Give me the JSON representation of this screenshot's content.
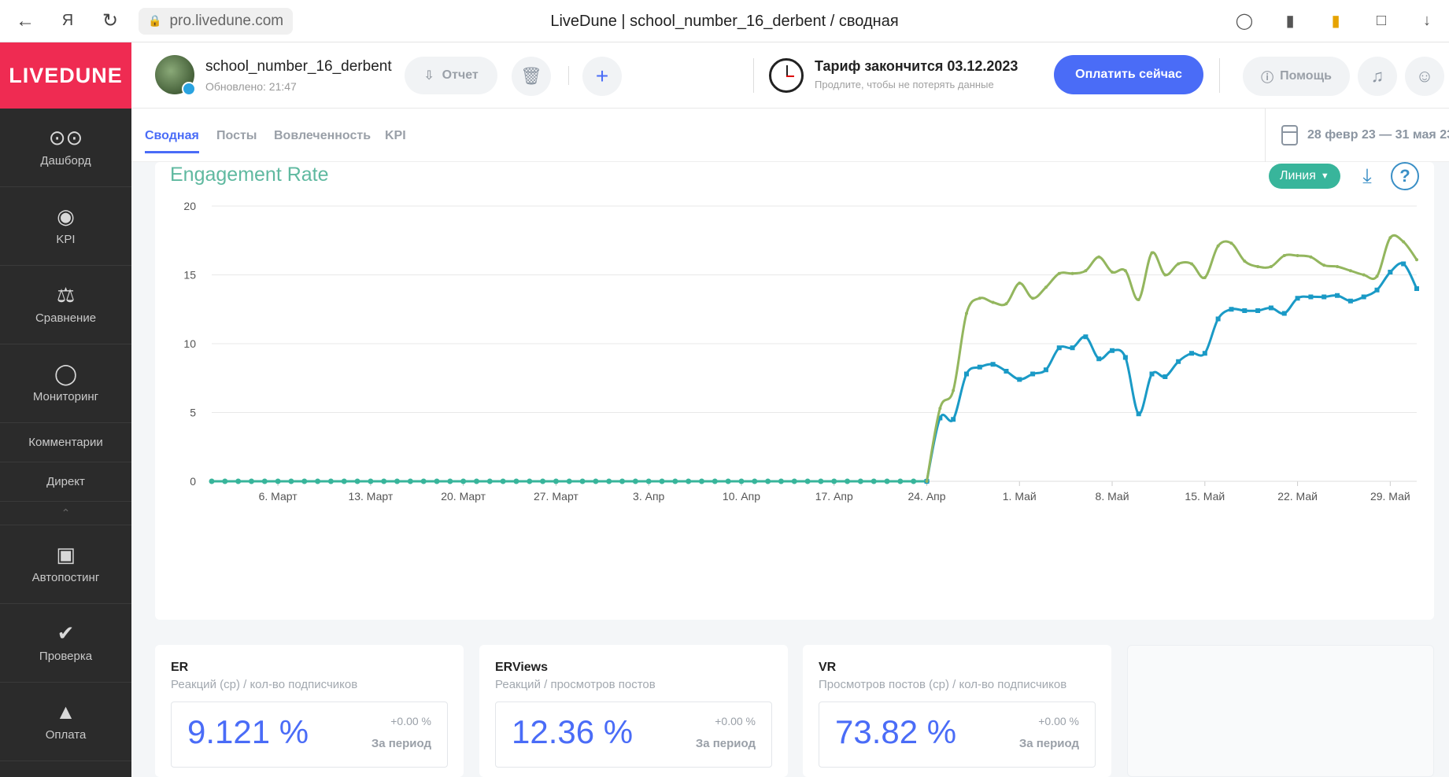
{
  "browser": {
    "url": "pro.livedune.com",
    "tab_title": "LiveDune | school_number_16_derbent / сводная"
  },
  "sidebar": {
    "brand": "LIVEDUNE",
    "items": [
      {
        "label": "Дашборд",
        "icon": "grid-icon"
      },
      {
        "label": "KPI",
        "icon": "target-icon"
      },
      {
        "label": "Сравнение",
        "icon": "scales-icon"
      },
      {
        "label": "Мониторинг",
        "icon": "chat-bubble-icon"
      }
    ],
    "sub_items": [
      "Комментарии",
      "Директ"
    ],
    "items2": [
      {
        "label": "Автопостинг",
        "icon": "calendar-plus-icon"
      },
      {
        "label": "Проверка",
        "icon": "shield-check-icon"
      },
      {
        "label": "Оплата",
        "icon": "basket-icon"
      }
    ]
  },
  "header": {
    "account_name": "school_number_16_derbent",
    "updated": "Обновлено: 21:47",
    "report_label": "Отчет",
    "tariff_title": "Тариф закончится 03.12.2023",
    "tariff_sub": "Продлите, чтобы не потерять данные",
    "pay_label": "Оплатить сейчас",
    "help_label": "Помощь"
  },
  "tabs": [
    "Сводная",
    "Посты",
    "Вовлеченность",
    "KPI"
  ],
  "date_range": "28 февр 23 — 31 мая 23",
  "chart": {
    "title": "Engagement Rate",
    "type_label": "Линия"
  },
  "chart_data": {
    "type": "line",
    "title": "Engagement Rate",
    "xlabel": "",
    "ylabel": "",
    "ylim": [
      0,
      20
    ],
    "yticks": [
      0,
      5,
      10,
      15,
      20
    ],
    "x_start": "2023-03-01",
    "x_ticks": [
      "6. Март",
      "13. Март",
      "20. Март",
      "27. Март",
      "3. Апр",
      "10. Апр",
      "17. Апр",
      "24. Апр",
      "1. Май",
      "8. Май",
      "15. Май",
      "22. Май",
      "29. Май"
    ],
    "grid": true,
    "legend": "none",
    "series": [
      {
        "color": "#93b65e",
        "values": [
          {
            "date": "2023-04-24",
            "value": 0
          },
          {
            "date": "2023-04-25",
            "value": 5.3
          },
          {
            "date": "2023-04-26",
            "value": 6.6
          },
          {
            "date": "2023-04-27",
            "value": 12.2
          },
          {
            "date": "2023-04-28",
            "value": 13.3
          },
          {
            "date": "2023-04-29",
            "value": 13.0
          },
          {
            "date": "2023-04-30",
            "value": 12.9
          },
          {
            "date": "2023-05-01",
            "value": 14.4
          },
          {
            "date": "2023-05-02",
            "value": 13.3
          },
          {
            "date": "2023-05-03",
            "value": 14.1
          },
          {
            "date": "2023-05-04",
            "value": 15.1
          },
          {
            "date": "2023-05-05",
            "value": 15.1
          },
          {
            "date": "2023-05-06",
            "value": 15.3
          },
          {
            "date": "2023-05-07",
            "value": 16.3
          },
          {
            "date": "2023-05-08",
            "value": 15.2
          },
          {
            "date": "2023-05-09",
            "value": 15.3
          },
          {
            "date": "2023-05-10",
            "value": 13.2
          },
          {
            "date": "2023-05-11",
            "value": 16.6
          },
          {
            "date": "2023-05-12",
            "value": 15.0
          },
          {
            "date": "2023-05-13",
            "value": 15.8
          },
          {
            "date": "2023-05-14",
            "value": 15.8
          },
          {
            "date": "2023-05-15",
            "value": 14.8
          },
          {
            "date": "2023-05-16",
            "value": 17.1
          },
          {
            "date": "2023-05-17",
            "value": 17.3
          },
          {
            "date": "2023-05-18",
            "value": 16.0
          },
          {
            "date": "2023-05-19",
            "value": 15.6
          },
          {
            "date": "2023-05-20",
            "value": 15.6
          },
          {
            "date": "2023-05-21",
            "value": 16.4
          },
          {
            "date": "2023-05-22",
            "value": 16.4
          },
          {
            "date": "2023-05-23",
            "value": 16.3
          },
          {
            "date": "2023-05-24",
            "value": 15.7
          },
          {
            "date": "2023-05-25",
            "value": 15.6
          },
          {
            "date": "2023-05-26",
            "value": 15.3
          },
          {
            "date": "2023-05-27",
            "value": 15.0
          },
          {
            "date": "2023-05-28",
            "value": 14.9
          },
          {
            "date": "2023-05-29",
            "value": 17.7
          },
          {
            "date": "2023-05-30",
            "value": 17.4
          },
          {
            "date": "2023-05-31",
            "value": 16.1
          }
        ]
      },
      {
        "color": "#1a9ac6",
        "values": [
          {
            "date": "2023-03-01",
            "value": 0
          },
          {
            "date": "2023-04-24",
            "value": 0
          },
          {
            "date": "2023-04-25",
            "value": 4.6
          },
          {
            "date": "2023-04-26",
            "value": 4.5
          },
          {
            "date": "2023-04-27",
            "value": 7.8
          },
          {
            "date": "2023-04-28",
            "value": 8.3
          },
          {
            "date": "2023-04-29",
            "value": 8.5
          },
          {
            "date": "2023-04-30",
            "value": 8.0
          },
          {
            "date": "2023-05-01",
            "value": 7.4
          },
          {
            "date": "2023-05-02",
            "value": 7.8
          },
          {
            "date": "2023-05-03",
            "value": 8.1
          },
          {
            "date": "2023-05-04",
            "value": 9.7
          },
          {
            "date": "2023-05-05",
            "value": 9.7
          },
          {
            "date": "2023-05-06",
            "value": 10.5
          },
          {
            "date": "2023-05-07",
            "value": 8.9
          },
          {
            "date": "2023-05-08",
            "value": 9.5
          },
          {
            "date": "2023-05-09",
            "value": 9.0
          },
          {
            "date": "2023-05-10",
            "value": 4.9
          },
          {
            "date": "2023-05-11",
            "value": 7.8
          },
          {
            "date": "2023-05-12",
            "value": 7.6
          },
          {
            "date": "2023-05-13",
            "value": 8.7
          },
          {
            "date": "2023-05-14",
            "value": 9.3
          },
          {
            "date": "2023-05-15",
            "value": 9.3
          },
          {
            "date": "2023-05-16",
            "value": 11.8
          },
          {
            "date": "2023-05-17",
            "value": 12.5
          },
          {
            "date": "2023-05-18",
            "value": 12.4
          },
          {
            "date": "2023-05-19",
            "value": 12.4
          },
          {
            "date": "2023-05-20",
            "value": 12.6
          },
          {
            "date": "2023-05-21",
            "value": 12.2
          },
          {
            "date": "2023-05-22",
            "value": 13.3
          },
          {
            "date": "2023-05-23",
            "value": 13.4
          },
          {
            "date": "2023-05-24",
            "value": 13.4
          },
          {
            "date": "2023-05-25",
            "value": 13.5
          },
          {
            "date": "2023-05-26",
            "value": 13.1
          },
          {
            "date": "2023-05-27",
            "value": 13.4
          },
          {
            "date": "2023-05-28",
            "value": 13.9
          },
          {
            "date": "2023-05-29",
            "value": 15.2
          },
          {
            "date": "2023-05-30",
            "value": 15.8
          },
          {
            "date": "2023-05-31",
            "value": 14.0
          }
        ]
      },
      {
        "color": "#38b59b",
        "values": [
          {
            "date": "2023-03-01",
            "value": 0
          },
          {
            "date": "2023-04-24",
            "value": 0
          }
        ],
        "daily_markers_from": "2023-03-01",
        "daily_markers_to": "2023-04-24"
      }
    ]
  },
  "metrics": [
    {
      "title": "ER",
      "subtitle": "Реакций (ср) / кол-во подписчиков",
      "value": "9.121 %",
      "delta": "+0.00 %",
      "period": "За период"
    },
    {
      "title": "ERViews",
      "subtitle": "Реакций / просмотров постов",
      "value": "12.36 %",
      "delta": "+0.00 %",
      "period": "За период"
    },
    {
      "title": "VR",
      "subtitle": "Просмотров постов (ср) / кол-во подписчиков",
      "value": "73.82 %",
      "delta": "+0.00 %",
      "period": "За период"
    }
  ]
}
